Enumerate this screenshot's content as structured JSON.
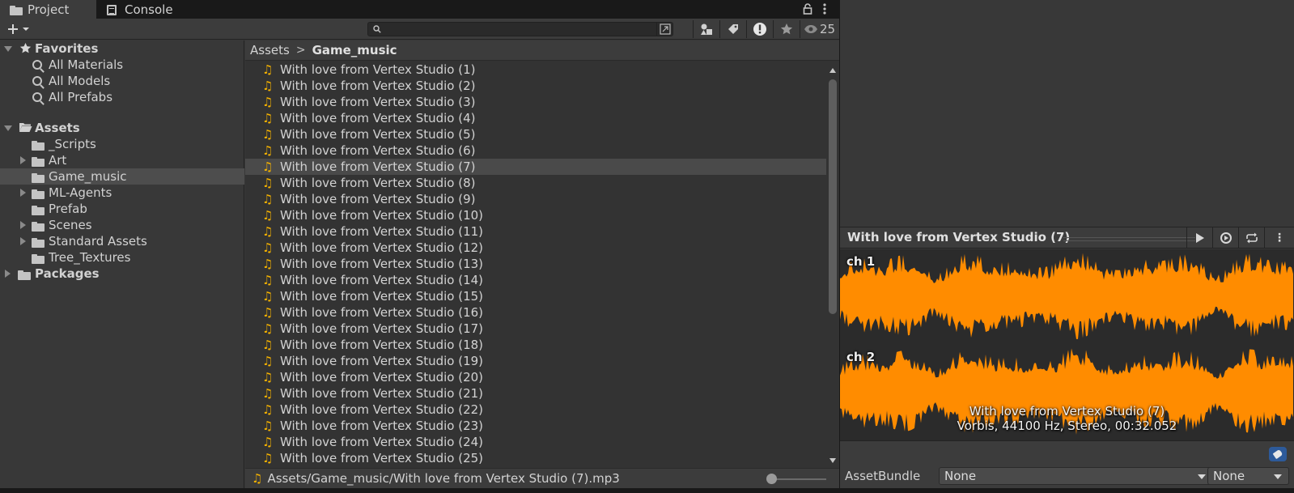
{
  "tabs": [
    {
      "label": "Project",
      "icon": "folder-icon",
      "active": true
    },
    {
      "label": "Console",
      "icon": "console-icon",
      "active": false
    }
  ],
  "toolbar": {
    "add_icon": "plus-icon",
    "search_placeholder": "",
    "hidden_count": "25"
  },
  "tree": {
    "favorites_label": "Favorites",
    "favorites": [
      "All Materials",
      "All Models",
      "All Prefabs"
    ],
    "assets_label": "Assets",
    "assets_children": [
      {
        "label": "_Scripts",
        "expandable": false
      },
      {
        "label": "Art",
        "expandable": true
      },
      {
        "label": "Game_music",
        "expandable": false,
        "selected": true
      },
      {
        "label": "ML-Agents",
        "expandable": true
      },
      {
        "label": "Prefab",
        "expandable": false
      },
      {
        "label": "Scenes",
        "expandable": true
      },
      {
        "label": "Standard Assets",
        "expandable": true
      },
      {
        "label": "Tree_Textures",
        "expandable": false
      }
    ],
    "packages_label": "Packages"
  },
  "breadcrumb": {
    "root": "Assets",
    "current": "Game_music"
  },
  "files": [
    "With love from Vertex Studio (1)",
    "With love from Vertex Studio (2)",
    "With love from Vertex Studio (3)",
    "With love from Vertex Studio (4)",
    "With love from Vertex Studio (5)",
    "With love from Vertex Studio (6)",
    "With love from Vertex Studio (7)",
    "With love from Vertex Studio (8)",
    "With love from Vertex Studio (9)",
    "With love from Vertex Studio (10)",
    "With love from Vertex Studio (11)",
    "With love from Vertex Studio (12)",
    "With love from Vertex Studio (13)",
    "With love from Vertex Studio (14)",
    "With love from Vertex Studio (15)",
    "With love from Vertex Studio (16)",
    "With love from Vertex Studio (17)",
    "With love from Vertex Studio (18)",
    "With love from Vertex Studio (19)",
    "With love from Vertex Studio (20)",
    "With love from Vertex Studio (21)",
    "With love from Vertex Studio (22)",
    "With love from Vertex Studio (23)",
    "With love from Vertex Studio (24)",
    "With love from Vertex Studio (25)"
  ],
  "selected_file_index": 6,
  "status": {
    "path": "Assets/Game_music/With love from Vertex Studio (7).mp3"
  },
  "preview": {
    "title": "With love from Vertex Studio (7)",
    "channels": [
      "ch 1",
      "ch 2"
    ],
    "info_name": "With love from Vertex Studio (7)",
    "info_format": "Vorbis, 44100 Hz, Stereo, 00:32.052",
    "waveform_color": "#ff8c00"
  },
  "assetbundle": {
    "label": "AssetBundle",
    "name_value": "None",
    "variant_value": "None"
  },
  "colors": {
    "accent": "#f5b200",
    "selection": "#4d4d4d",
    "tag_button": "#2d5a9a"
  }
}
